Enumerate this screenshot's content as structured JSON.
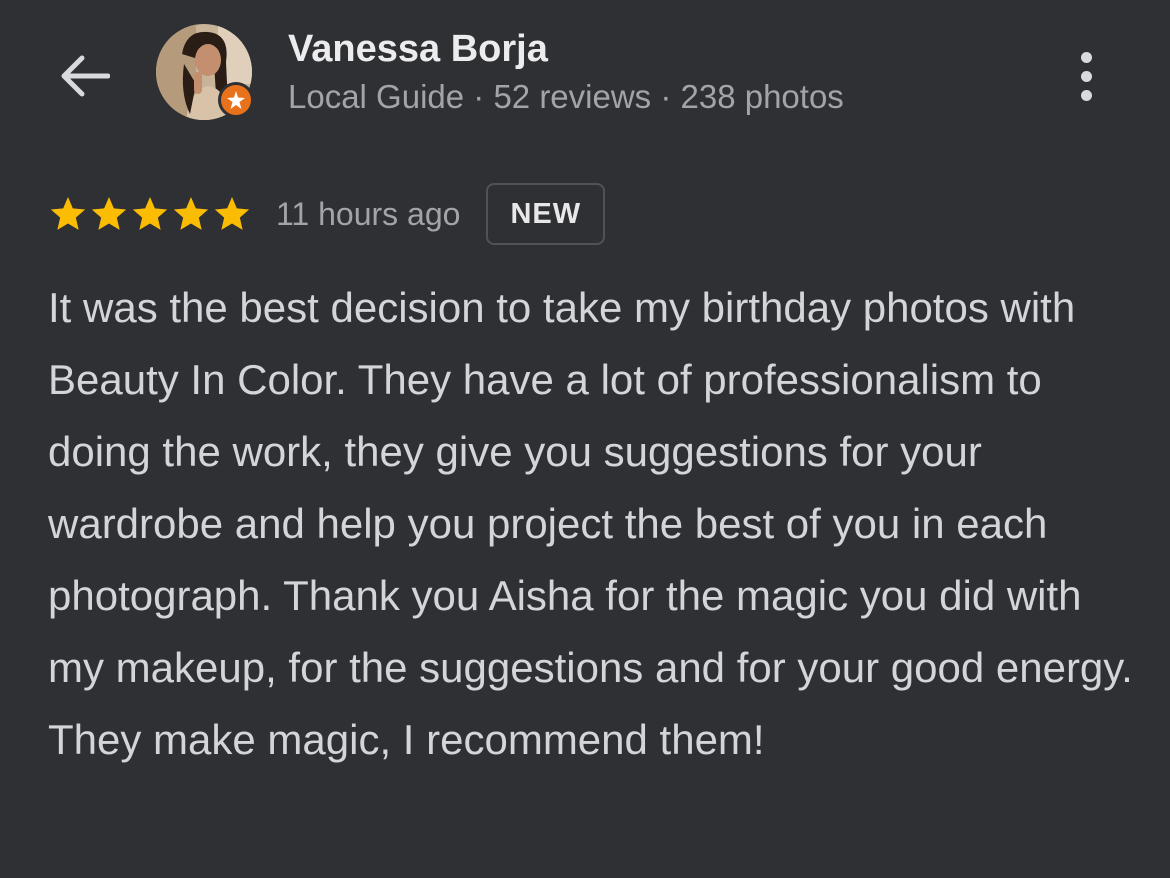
{
  "header": {
    "back_icon": "arrow-left-icon",
    "reviewer_name": "Vanessa Borja",
    "reviewer_meta": "Local Guide · 52 reviews · 238 photos",
    "badge_icon": "local-guide-star-icon",
    "more_icon": "more-vertical-icon"
  },
  "review": {
    "rating": 5,
    "max_rating": 5,
    "time_ago": "11 hours ago",
    "badge": "NEW",
    "text": "It was the best decision to take my birthday photos with Beauty In Color. They have a lot of professionalism to doing the work, they give you suggestions for your wardrobe and help you project the best of you in each photograph. Thank you Aisha for the magic you did with my makeup, for the suggestions and for your good energy. They make magic, I recommend them!"
  },
  "colors": {
    "background": "#2f3033",
    "star": "#fbbc04",
    "guide_badge": "#e8711c",
    "primary_text": "#ececee",
    "secondary_text": "#a3a4a9"
  }
}
